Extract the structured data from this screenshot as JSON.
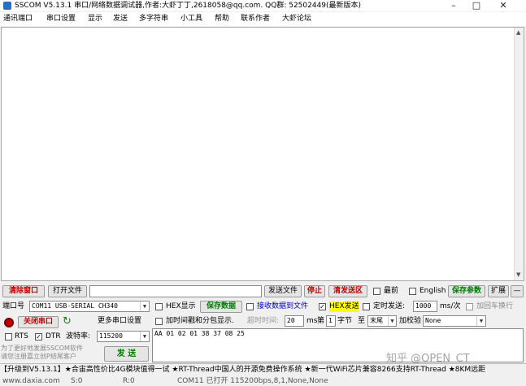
{
  "window": {
    "title": "SSCOM V5.13.1 串口/网络数据调试器,作者:大虾丁丁,2618058@qq.com. QQ群: 52502449(最新版本)",
    "minimize": "–",
    "maximize": "□",
    "close": "✕"
  },
  "menu": [
    "通讯端口",
    "串口设置",
    "显示",
    "发送",
    "多字符串",
    "小工具",
    "帮助",
    "联系作者",
    "大虾论坛"
  ],
  "toolbar": {
    "clear_window": "清除窗口",
    "open_file": "打开文件",
    "file_path": "",
    "send_file": "发送文件",
    "stop": "停止",
    "clear_send": "清发送区",
    "topmost": "最前",
    "english": "English",
    "save_params": "保存参数",
    "expand": "扩展",
    "collapse": "—"
  },
  "port": {
    "label": "端口号",
    "value": "COM11 USB-SERIAL CH340",
    "open_close": "关闭串口",
    "more_settings": "更多串口设置",
    "rts": "RTS",
    "dtr": "DTR",
    "baud_label": "波特率:",
    "baud_value": "115200"
  },
  "options": {
    "hex_display": "HEX显示",
    "save_data": "保存数据",
    "recv_to_file": "接收数据到文件",
    "hex_send": "HEX发送",
    "timed_send": "定时发送:",
    "interval": "1000",
    "interval_unit": "ms/次",
    "add_crlf": "加回车换行",
    "timestamp": "加时间戳和分包显示.",
    "timeout_label": "超时时间:",
    "timeout_value": "20",
    "timeout_unit": "ms",
    "byte_prefix": "第",
    "byte_index": "1",
    "byte_unit": "字节",
    "to_label": "至",
    "to_value": "末尾",
    "checksum_label": "加校验",
    "checksum_value": "None"
  },
  "send": {
    "data": "AA 01 02 01 38 37 08 25",
    "button": "发 送",
    "promo": "为了更好地发展SSCOM软件\n请您注册嘉立创P结尾客户"
  },
  "status_bar": "【升级到V5.13.1】★合宙高性价比4G模块值得一试 ★RT-Thread中国人的开源免费操作系统 ★新一代WiFi芯片兼容8266支持RT-Thread ★8KM远距",
  "bottom_bar": {
    "url": "www.daxia.com",
    "s": "S:0",
    "r": "R:0",
    "port_status": "COM11 已打开  115200bps,8,1,None,None"
  },
  "watermark": "知乎 @OPEN_CT"
}
